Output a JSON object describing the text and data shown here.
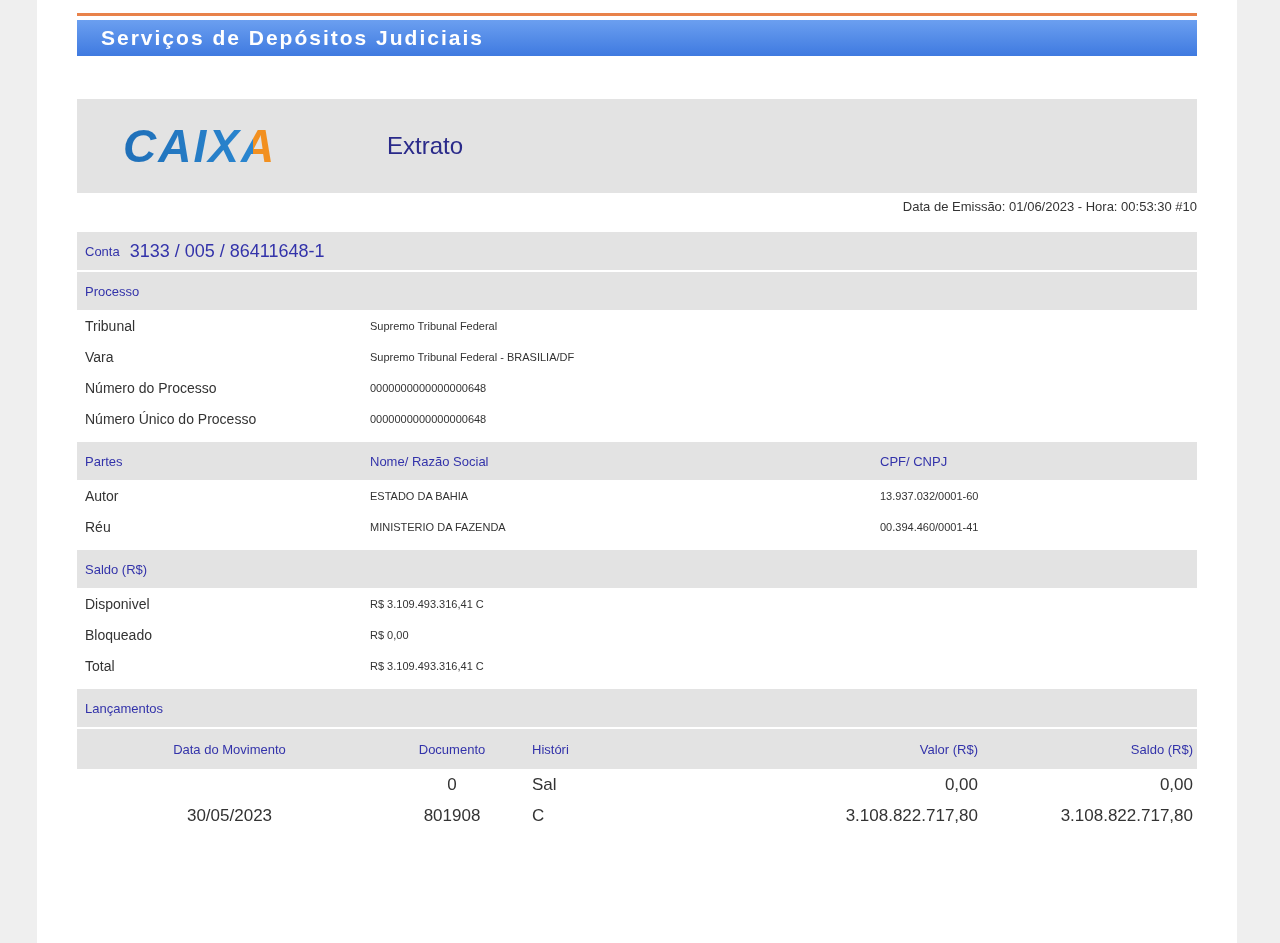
{
  "banner": {
    "title": "Serviços de Depósitos Judiciais"
  },
  "header": {
    "logo": "CAIXA",
    "title": "Extrato",
    "emission": "Data de Emissão: 01/06/2023 - Hora: 00:53:30 #10"
  },
  "account": {
    "label": "Conta",
    "number": "3133 / 005 / 86411648-1"
  },
  "sections": [
    {
      "header": [
        "Processo"
      ],
      "rows": [
        {
          "cells": [
            "Tribunal",
            "Supremo Tribunal Federal"
          ]
        },
        {
          "cells": [
            "Vara",
            "Supremo Tribunal Federal - BRASILIA/DF"
          ]
        },
        {
          "cells": [
            "Número do Processo",
            "0000000000000000648"
          ]
        },
        {
          "cells": [
            "Número Único do Processo",
            "0000000000000000648"
          ]
        }
      ]
    },
    {
      "header": [
        "Partes",
        "Nome/ Razão Social",
        "CPF/ CNPJ"
      ],
      "rows": [
        {
          "cells": [
            "Autor",
            "ESTADO DA BAHIA",
            "13.937.032/0001-60"
          ]
        },
        {
          "cells": [
            "Réu",
            "MINISTERIO DA FAZENDA",
            "00.394.460/0001-41"
          ]
        }
      ]
    },
    {
      "header": [
        "Saldo (R$)"
      ],
      "rows": [
        {
          "cells": [
            "Disponivel",
            "R$ 3.109.493.316,41 C"
          ]
        },
        {
          "cells": [
            "Bloqueado",
            "R$ 0,00"
          ]
        },
        {
          "cells": [
            "Total",
            "R$ 3.109.493.316,41 C"
          ]
        }
      ]
    }
  ],
  "entries": {
    "title": "Lançamentos",
    "columns": [
      "Data do Movimento",
      "Documento",
      "Históri",
      "Valor (R$)",
      "Saldo (R$)"
    ],
    "rows": [
      {
        "cells": [
          "",
          "0",
          "Sal",
          "0,00",
          "0,00"
        ]
      },
      {
        "cells": [
          "30/05/2023",
          "801908",
          "C",
          "3.108.822.717,80",
          "3.108.822.717,80"
        ]
      }
    ]
  }
}
